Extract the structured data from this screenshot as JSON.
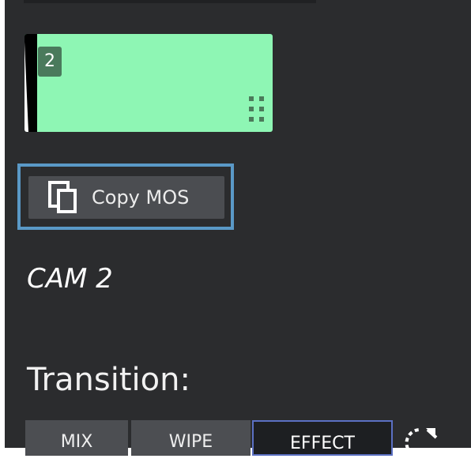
{
  "thumbnail": {
    "number": "2",
    "color": "#8ef6b4"
  },
  "copy_mos": {
    "label": "Copy MOS",
    "icon": "copy-icon"
  },
  "source": {
    "label": "CAM 2"
  },
  "transition": {
    "heading": "Transition:",
    "tabs": [
      {
        "label": "MIX",
        "active": false
      },
      {
        "label": "WIPE",
        "active": false
      },
      {
        "label": "EFFECT",
        "active": true
      }
    ],
    "reset_icon": "rotate-reset-icon"
  },
  "colors": {
    "background": "#2b2c2e",
    "accent": "#5a99c7",
    "active_tab_border": "#5b70c3"
  }
}
